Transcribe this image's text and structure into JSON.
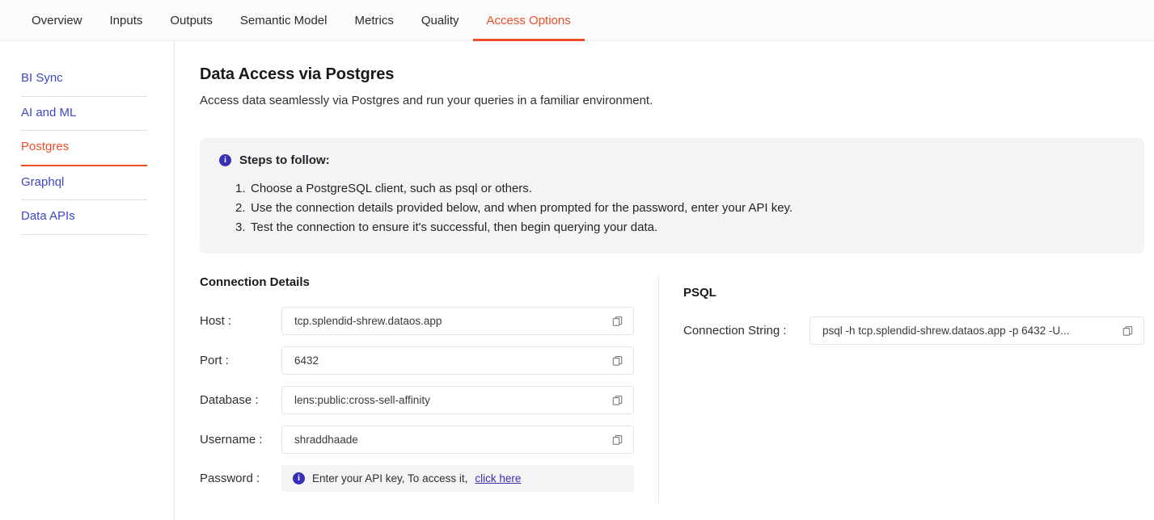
{
  "tabs": [
    {
      "label": "Overview",
      "active": false
    },
    {
      "label": "Inputs",
      "active": false
    },
    {
      "label": "Outputs",
      "active": false
    },
    {
      "label": "Semantic Model",
      "active": false
    },
    {
      "label": "Metrics",
      "active": false
    },
    {
      "label": "Quality",
      "active": false
    },
    {
      "label": "Access Options",
      "active": true
    }
  ],
  "sidebar": {
    "items": [
      {
        "label": "BI Sync"
      },
      {
        "label": "AI and ML"
      },
      {
        "label": "Postgres"
      },
      {
        "label": "Graphql"
      },
      {
        "label": "Data APIs"
      }
    ]
  },
  "main": {
    "title": "Data Access via Postgres",
    "subtitle": "Access data seamlessly via Postgres and run your queries in a familiar environment.",
    "steps": {
      "heading": "Steps to follow:",
      "items": [
        "Choose a PostgreSQL client, such as psql or others.",
        "Use the connection details provided below, and when prompted for the password, enter your API key.",
        "Test the connection to ensure it's successful, then begin querying your data."
      ]
    },
    "connection": {
      "title": "Connection Details",
      "fields": [
        {
          "label": "Host :",
          "value": "tcp.splendid-shrew.dataos.app"
        },
        {
          "label": "Port :",
          "value": "6432"
        },
        {
          "label": "Database :",
          "value": "lens:public:cross-sell-affinity"
        },
        {
          "label": "Username :",
          "value": "shraddhaade"
        }
      ],
      "password": {
        "label": "Password :",
        "text": "Enter your API key, To access it,",
        "link": "click here"
      }
    },
    "psql": {
      "title": "PSQL",
      "label": "Connection String :",
      "value": "psql -h tcp.splendid-shrew.dataos.app -p 6432 -U..."
    }
  },
  "colors": {
    "accent": "#ef4e28",
    "link": "#3f47c4",
    "info": "#3730b5",
    "panel": "#f4f4f5"
  },
  "icons": {
    "copy": "copy-icon",
    "info": "info-icon"
  }
}
